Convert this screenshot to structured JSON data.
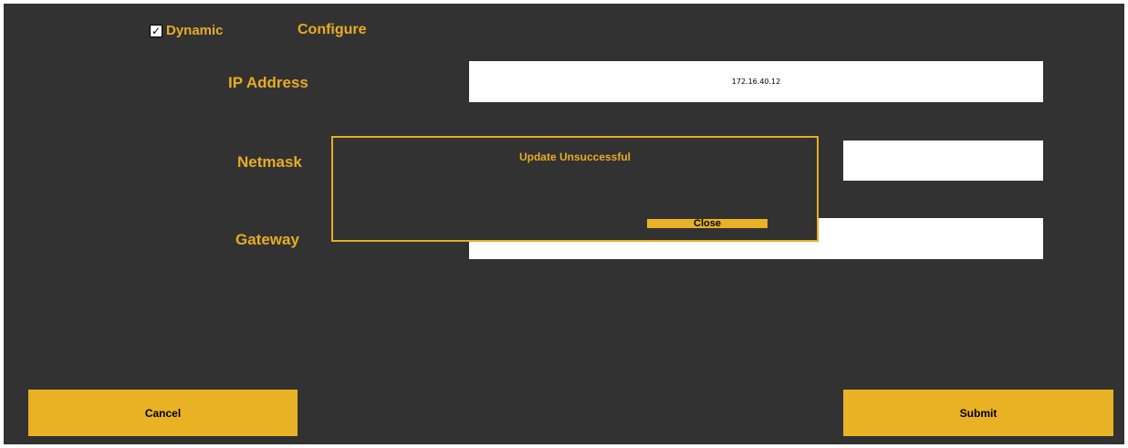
{
  "header": {
    "dynamic_label": "Dynamic",
    "dynamic_checked": true,
    "configure_label": "Configure"
  },
  "fields": {
    "ip_label": "IP Address",
    "ip_value": "172.16.40.12",
    "netmask_label": "Netmask",
    "netmask_value": "",
    "gateway_label": "Gateway",
    "gateway_value": ""
  },
  "dialog": {
    "message": "Update Unsuccessful",
    "close_label": "Close"
  },
  "footer": {
    "cancel_label": "Cancel",
    "submit_label": "Submit"
  },
  "colors": {
    "background": "#323232",
    "accent": "#e8b224",
    "label_text": "#e8ac22"
  },
  "icons": {
    "checkbox": "checkmark-icon"
  }
}
